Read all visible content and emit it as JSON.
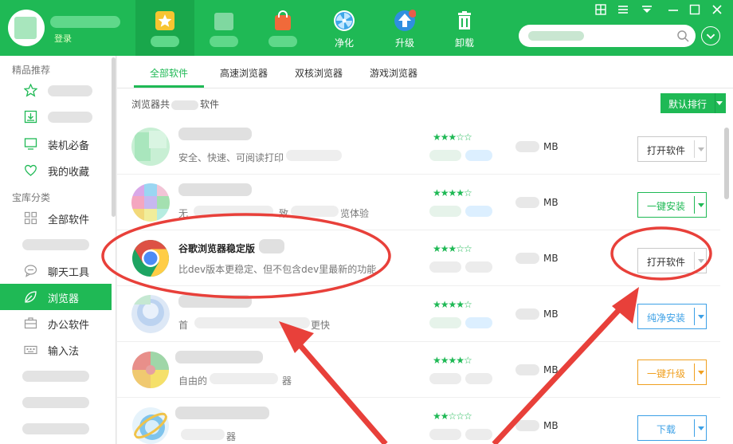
{
  "header": {
    "login_label": "登录",
    "nav": [
      {
        "id": "recommend",
        "label": "",
        "icon": "star-icon"
      },
      {
        "id": "blurred-1",
        "label": "",
        "icon": "app-icon"
      },
      {
        "id": "store",
        "label": "",
        "icon": "shopping-bag-icon"
      },
      {
        "id": "clean",
        "label": "净化",
        "icon": "fan-icon"
      },
      {
        "id": "upgrade",
        "label": "升级",
        "icon": "upload-arrow-icon"
      },
      {
        "id": "uninstall",
        "label": "卸载",
        "icon": "trash-icon"
      }
    ],
    "search_placeholder": ""
  },
  "sidebar": {
    "section_featured": "精品推荐",
    "section_library": "宝库分类",
    "items": [
      {
        "label": "",
        "icon": "star-outline-icon"
      },
      {
        "label": "",
        "icon": "download-box-icon"
      },
      {
        "label": "装机必备",
        "icon": "monitor-icon"
      },
      {
        "label": "我的收藏",
        "icon": "heart-icon"
      },
      {
        "label": "全部软件",
        "icon": "grid-icon"
      },
      {
        "label": "",
        "icon": ""
      },
      {
        "label": "聊天工具",
        "icon": "chat-icon"
      },
      {
        "label": "浏览器",
        "icon": "browser-leaf-icon",
        "active": true
      },
      {
        "label": "办公软件",
        "icon": "briefcase-icon"
      },
      {
        "label": "输入法",
        "icon": "keyboard-icon"
      }
    ]
  },
  "main": {
    "tabs": [
      "全部软件",
      "高速浏览器",
      "双核浏览器",
      "游戏浏览器"
    ],
    "active_tab": 0,
    "count_prefix": "浏览器共",
    "count_suffix": "软件",
    "sort_label": "默认排行",
    "rows": [
      {
        "name": "",
        "desc": "安全、快速、可阅读打印",
        "stars": "★★★☆☆",
        "unit": "MB",
        "action": "打开软件",
        "style": "gray"
      },
      {
        "name": "",
        "desc": "无",
        "desc_tail": "致",
        "desc_tail2": "览体验",
        "stars": "★★★★☆",
        "unit": "MB",
        "action": "一键安装",
        "style": "green"
      },
      {
        "name": "谷歌浏览器稳定版",
        "desc": "比dev版本更稳定、但不包含dev里最新的功能",
        "stars": "★★★☆☆",
        "unit": "MB",
        "action": "打开软件",
        "style": "gray"
      },
      {
        "name": "",
        "desc": "首",
        "desc_tail": "更快",
        "stars": "★★★★☆",
        "unit": "MB",
        "action": "纯净安装",
        "style": "blue"
      },
      {
        "name": "",
        "desc": "自由的",
        "desc_tail": "器",
        "stars": "★★★★☆",
        "unit": "MB",
        "action": "一键升级",
        "style": "orange"
      },
      {
        "name": "",
        "desc": "",
        "desc_tail": "器",
        "stars": "★★☆☆☆",
        "unit": "MB",
        "action": "下载",
        "style": "blue"
      }
    ]
  },
  "colors": {
    "brand_green": "#1fb955",
    "annotation_red": "#e8403a"
  }
}
